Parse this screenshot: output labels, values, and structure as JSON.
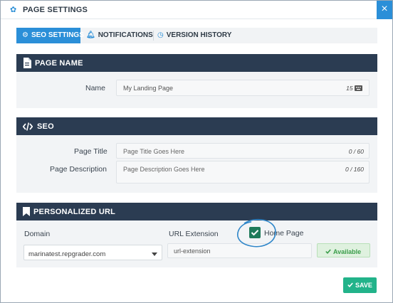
{
  "dialog": {
    "title": "PAGE SETTINGS",
    "close_glyph": "×"
  },
  "tabs": [
    {
      "label": "SEO SETTINGS",
      "icon": "gears-icon",
      "active": true
    },
    {
      "label": "NOTIFICATIONS",
      "icon": "bell-icon",
      "active": false
    },
    {
      "label": "VERSION HISTORY",
      "icon": "clock-icon",
      "active": false
    }
  ],
  "page_name": {
    "header": "PAGE NAME",
    "icon": "file-icon",
    "name_label": "Name",
    "name_value": "My Landing Page",
    "name_count": "15"
  },
  "seo": {
    "header": "SEO",
    "icon": "code-icon",
    "title_label": "Page Title",
    "title_placeholder": "Page Title Goes Here",
    "title_count": "0 / 60",
    "desc_label": "Page Description",
    "desc_placeholder": "Page Description Goes Here",
    "desc_count": "0 / 160"
  },
  "url": {
    "header": "PERSONALIZED URL",
    "icon": "bookmark-icon",
    "domain_label": "Domain",
    "domain_value": "marinatest.repgrader.com",
    "ext_label": "URL Extension",
    "ext_value": "url-extension",
    "home_label": "Home Page",
    "home_checked": true,
    "available_label": "Available"
  },
  "footer": {
    "save_label": "SAVE"
  },
  "colors": {
    "accent": "#2b8fd8",
    "header_bg": "#2b3c52",
    "save_green": "#22b38a",
    "check_green": "#1f7a5a",
    "available_text": "#3a9d4a"
  }
}
